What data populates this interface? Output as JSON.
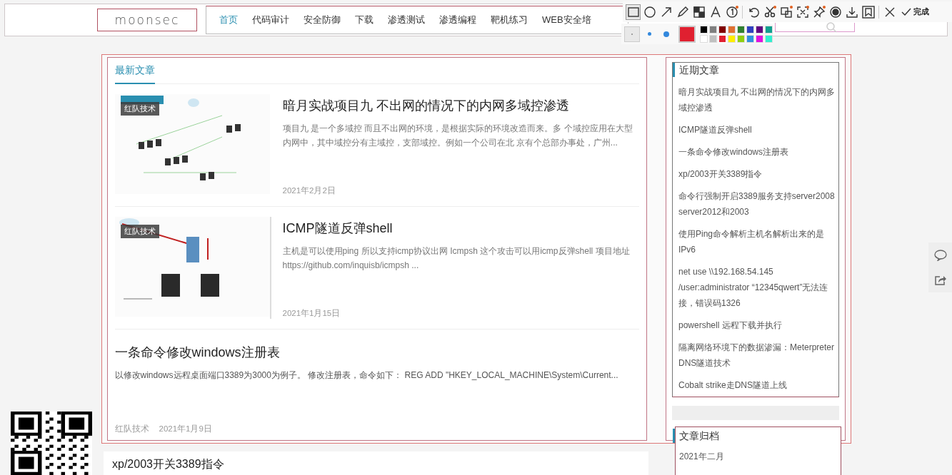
{
  "header": {
    "logo": "moonsec",
    "nav": [
      {
        "label": "首页",
        "selected": true
      },
      {
        "label": "代码审计",
        "selected": false
      },
      {
        "label": "安全防御",
        "selected": false
      },
      {
        "label": "下载",
        "selected": false
      },
      {
        "label": "渗透测试",
        "selected": false
      },
      {
        "label": "渗透编程",
        "selected": false
      },
      {
        "label": "靶机练习",
        "selected": false
      },
      {
        "label": "WEB安全培",
        "selected": false
      }
    ]
  },
  "annotation_toolbar": {
    "groups": [
      [
        {
          "kind": "rectangle",
          "selected": true,
          "new": false
        },
        {
          "kind": "ellipse",
          "selected": false,
          "new": false
        },
        {
          "kind": "arrow",
          "selected": false,
          "new": false
        },
        {
          "kind": "pencil",
          "selected": false,
          "new": false
        },
        {
          "kind": "mosaic",
          "selected": false,
          "new": false
        },
        {
          "kind": "text",
          "selected": false,
          "new": false
        },
        {
          "kind": "number",
          "selected": false,
          "new": true
        }
      ],
      [
        {
          "kind": "undo",
          "selected": false,
          "new": false
        },
        {
          "kind": "scissors",
          "selected": false,
          "new": true
        },
        {
          "kind": "ocr",
          "selected": false,
          "new": true
        },
        {
          "kind": "scan",
          "selected": false,
          "new": true
        },
        {
          "kind": "pin",
          "selected": false,
          "new": true
        },
        {
          "kind": "record",
          "selected": false,
          "new": false
        },
        {
          "kind": "download",
          "selected": false,
          "new": false
        },
        {
          "kind": "bookmark",
          "selected": false,
          "new": false
        }
      ]
    ],
    "done": "完成",
    "sizes": [
      {
        "selected": true
      },
      {
        "selected": false
      },
      {
        "selected": false
      }
    ],
    "swatches": [
      {
        "color": "#000000",
        "selected": false
      },
      {
        "color": "#7f7f7f",
        "selected": false
      },
      {
        "color": "#800000",
        "selected": false
      },
      {
        "color": "#e07030",
        "selected": false
      },
      {
        "color": "#308030",
        "selected": false
      },
      {
        "color": "#3040c0",
        "selected": false
      },
      {
        "color": "#600080",
        "selected": false
      },
      {
        "color": "#10a090",
        "selected": false
      },
      {
        "color": "#ffffff",
        "selected": false
      },
      {
        "color": "#c0c0c0",
        "selected": false
      },
      {
        "color": "#e02030",
        "selected": true
      },
      {
        "color": "#ffee00",
        "selected": false
      },
      {
        "color": "#90d010",
        "selected": false
      },
      {
        "color": "#3090e0",
        "selected": false
      },
      {
        "color": "#e010e0",
        "selected": false
      },
      {
        "color": "#30f0d0",
        "selected": false
      }
    ]
  },
  "latest": {
    "tab": "最新文章",
    "articles": [
      {
        "tag": "红队技术",
        "title": "暗月实战项目九 不出网的情况下的内网多域控渗透",
        "excerpt": "项目九 是一个多域控 而且不出网的环境，是根据实际的环境改造而来。多 个域控应用在大型内网中，其中域控分有主域控，支部域控。例如一个公司在北 京有个总部办事处，广州...",
        "date": "2021年2月2日"
      },
      {
        "tag": "红队技术",
        "title": "ICMP隧道反弹shell",
        "excerpt": "主机是可以使用ping 所以支持icmp协议出网 Icmpsh 这个攻击可以用icmp反弹shell 项目地址 https://github.com/inquisb/icmpsh ...",
        "date": "2021年1月15日"
      },
      {
        "kind": "text",
        "tag": "红队技术",
        "title": "一条命令修改windows注册表",
        "excerpt": "以修改windows远程桌面端口3389为3000为例子。 修改注册表，命令如下： REG ADD \"HKEY_LOCAL_MACHINE\\System\\Current...",
        "date": "2021年1月9日"
      }
    ]
  },
  "next_article": {
    "title": "xp/2003开关3389指令"
  },
  "sidebar": {
    "recent": {
      "title": "近期文章",
      "items": [
        "暗月实战项目九 不出网的情况下的内网多域控渗透",
        "ICMP隧道反弹shell",
        "一条命令修改windows注册表",
        "xp/2003开关3389指令",
        "命令行强制开启3389服务支持server2008 server2012和2003",
        "使用Ping命令解析主机名解析出来的是IPv6",
        "net use \\\\192.168.54.145 /user:administrator “12345qwert”无法连接，错误码1326",
        "powershell 远程下载并执行",
        "隔离网络环境下的数据渗漏：Meterpreter DNS隧道技术",
        "Cobalt strike走DNS隧道上线"
      ]
    },
    "archive": {
      "title": "文章归档",
      "items": [
        "2021年二月"
      ]
    }
  }
}
